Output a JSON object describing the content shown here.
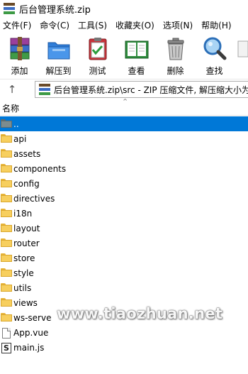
{
  "window": {
    "title": "后台管理系统.zip"
  },
  "menu": [
    {
      "label": "文件(F)"
    },
    {
      "label": "命令(C)"
    },
    {
      "label": "工具(S)"
    },
    {
      "label": "收藏夹(O)"
    },
    {
      "label": "选项(N)"
    },
    {
      "label": "帮助(H)"
    }
  ],
  "toolbar": [
    {
      "label": "添加",
      "icon": "add-archive-icon"
    },
    {
      "label": "解压到",
      "icon": "extract-to-icon"
    },
    {
      "label": "测试",
      "icon": "test-icon"
    },
    {
      "label": "查看",
      "icon": "view-book-icon"
    },
    {
      "label": "删除",
      "icon": "trash-icon"
    },
    {
      "label": "查找",
      "icon": "magnifier-icon"
    }
  ],
  "address": {
    "path": "后台管理系统.zip\\src - ZIP 压缩文件, 解压缩大小为"
  },
  "columns": {
    "name": "名称"
  },
  "files": [
    {
      "name": "..",
      "type": "up",
      "selected": true
    },
    {
      "name": "api",
      "type": "folder"
    },
    {
      "name": "assets",
      "type": "folder"
    },
    {
      "name": "components",
      "type": "folder"
    },
    {
      "name": "config",
      "type": "folder"
    },
    {
      "name": "directives",
      "type": "folder"
    },
    {
      "name": "i18n",
      "type": "folder"
    },
    {
      "name": "layout",
      "type": "folder"
    },
    {
      "name": "router",
      "type": "folder"
    },
    {
      "name": "store",
      "type": "folder"
    },
    {
      "name": "style",
      "type": "folder"
    },
    {
      "name": "utils",
      "type": "folder"
    },
    {
      "name": "views",
      "type": "folder"
    },
    {
      "name": "ws-serve",
      "type": "folder"
    },
    {
      "name": "App.vue",
      "type": "file"
    },
    {
      "name": "main.js",
      "type": "js"
    }
  ],
  "watermark": "www.tiaozhuan.net",
  "colors": {
    "selection": "#0078d7",
    "folder": "#f7cf5e"
  }
}
